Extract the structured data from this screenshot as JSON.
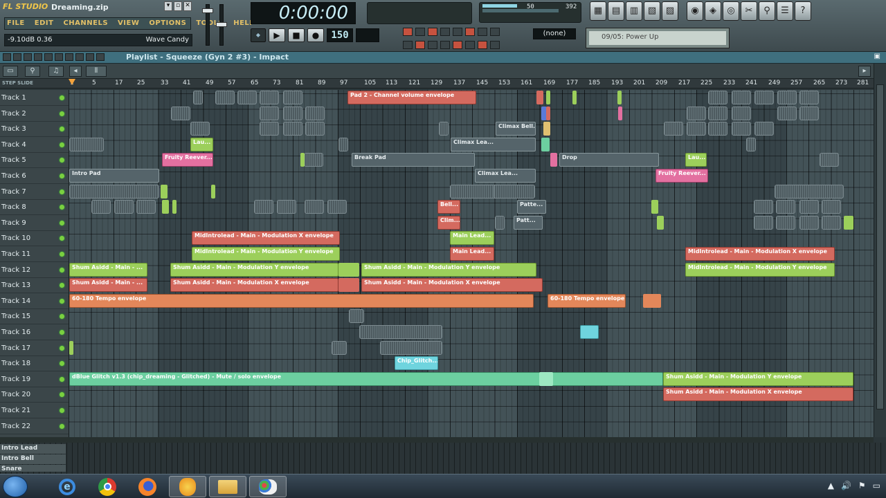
{
  "app": {
    "logo": "FL STUDIO",
    "file": "Dreaming.zip",
    "window_buttons": [
      "▾",
      "▫",
      "✕"
    ]
  },
  "menu": [
    "FILE",
    "EDIT",
    "CHANNELS",
    "VIEW",
    "OPTIONS",
    "TOOLS",
    "HELP"
  ],
  "hint": {
    "left": "-9.10dB  0.36",
    "right": "Wave Candy"
  },
  "time": "0:00:00",
  "tempo": "150",
  "pattern": "",
  "meter": {
    "cpu": "50",
    "poly": "392"
  },
  "snap": "(none)",
  "browser_item": "09/05: Power Up",
  "playlist_title": "Playlist - Squeeze (Gyn 2 #3) - Impact",
  "ruler_label": "STEP  SLIDE",
  "ruler": [
    "1",
    "5",
    "17",
    "25",
    "33",
    "41",
    "49",
    "57",
    "65",
    "73",
    "81",
    "89",
    "97",
    "105",
    "113",
    "121",
    "129",
    "137",
    "145",
    "153",
    "161",
    "169",
    "177",
    "185",
    "193",
    "201",
    "209",
    "217",
    "225",
    "233",
    "241",
    "249",
    "257",
    "265",
    "273",
    "281"
  ],
  "tracks": [
    "Track 1",
    "Track 2",
    "Track 3",
    "Track 4",
    "Track 5",
    "Track 6",
    "Track 7",
    "Track 8",
    "Track 9",
    "Track 10",
    "Track 11",
    "Track 12",
    "Track 13",
    "Track 14",
    "Track 15",
    "Track 16",
    "Track 17",
    "Track 18",
    "Track 19",
    "Track 20",
    "Track 21",
    "Track 22"
  ],
  "clips": [
    {
      "label": "Pad 2 - Channel volume envelope",
      "color": "red"
    },
    {
      "label": "Climax Bell...",
      "color": "dark"
    },
    {
      "label": "Climax Lea...",
      "color": "dark"
    },
    {
      "label": "Lau...",
      "color": "green"
    },
    {
      "label": "Fruity Reever...",
      "color": "pink"
    },
    {
      "label": "Break Pad",
      "color": "dark"
    },
    {
      "label": "Climax Lea...",
      "color": "dark"
    },
    {
      "label": "Drop",
      "color": "dark"
    },
    {
      "label": "Lau...",
      "color": "green"
    },
    {
      "label": "Intro Pad",
      "color": "dark"
    },
    {
      "label": "Fruity Reever...",
      "color": "pink"
    },
    {
      "label": "Bell...",
      "color": "red"
    },
    {
      "label": "Patte...",
      "color": "dark"
    },
    {
      "label": "Clim...",
      "color": "red"
    },
    {
      "label": "Patt...",
      "color": "dark"
    },
    {
      "label": "MidIntrolead - Main - Modulation X envelope",
      "color": "red"
    },
    {
      "label": "Main Lead...",
      "color": "green"
    },
    {
      "label": "MidIntrolead - Main - Modulation Y envelope",
      "color": "green"
    },
    {
      "label": "Main Lead...",
      "color": "red"
    },
    {
      "label": "MidIntrolead - Main - Modulation X envelope",
      "color": "red"
    },
    {
      "label": "Shum Asidd - Main - ...",
      "color": "green"
    },
    {
      "label": "Shum Asidd - Main - Modulation Y envelope",
      "color": "green"
    },
    {
      "label": "Shum Asidd - Main - Modulation Y envelope",
      "color": "green"
    },
    {
      "label": "MidIntrolead - Main - Modulation Y envelope",
      "color": "green"
    },
    {
      "label": "Shum Asidd - Main - ...",
      "color": "red"
    },
    {
      "label": "Shum Asidd - Main - Modulation X envelope",
      "color": "red"
    },
    {
      "label": "Shum Asidd - Main - Modulation X envelope",
      "color": "red"
    },
    {
      "label": "60-180 Tempo envelope",
      "color": "orange"
    },
    {
      "label": "60-180 Tempo envelope",
      "color": "orange"
    },
    {
      "label": "Chip_Glitch...",
      "color": "cyan"
    },
    {
      "label": "dBlue Glitch v1.3 (chip_dreaming - Glitched) - Mute / solo envelope",
      "color": "teal"
    },
    {
      "label": "Shum Asidd - Main - Modulation Y envelope",
      "color": "green"
    },
    {
      "label": "Shum Asidd - Main - Modulation X envelope",
      "color": "red"
    }
  ],
  "bottom_rows": [
    "Intro Lead",
    "Intro Bell",
    "Snare"
  ],
  "taskbar": [
    "Internet Explorer",
    "Google Chrome",
    "Firefox",
    "FL Studio",
    "Explorer",
    "Paint"
  ],
  "tray": [
    "▲",
    "🔊",
    "⚑",
    "▭"
  ]
}
